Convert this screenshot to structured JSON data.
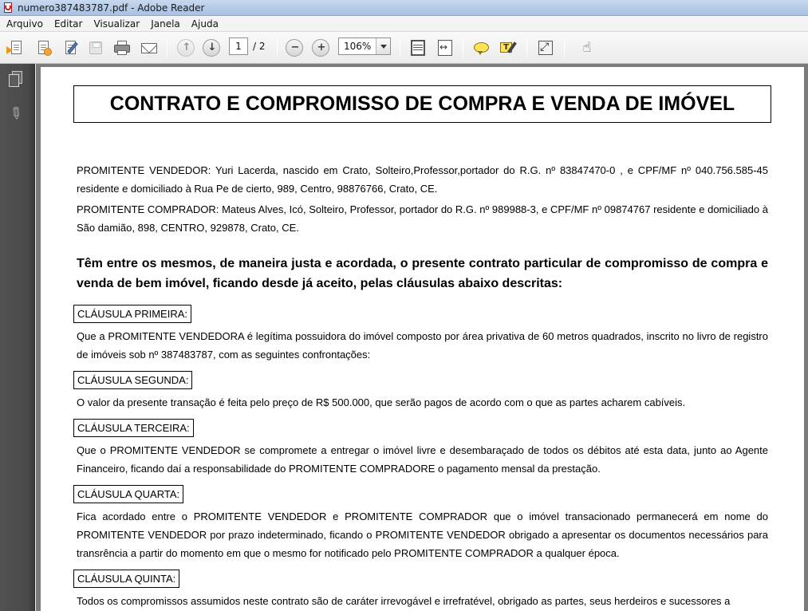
{
  "window": {
    "title": "numero387483787.pdf - Adobe Reader"
  },
  "menu": {
    "items": [
      "Arquivo",
      "Editar",
      "Visualizar",
      "Janela",
      "Ajuda"
    ]
  },
  "toolbar": {
    "current_page": "1",
    "total_pages": "/ 2",
    "zoom": "106%",
    "icons": [
      "open-file-icon",
      "create-pdf-icon",
      "sign-icon",
      "save-icon",
      "print-icon",
      "email-icon",
      "previous-page-icon",
      "next-page-icon",
      "zoom-out-icon",
      "zoom-in-icon",
      "fit-page-icon",
      "fit-width-icon",
      "comment-icon",
      "highlight-icon",
      "full-screen-icon",
      "hand-tool-icon"
    ]
  },
  "sidepanel": {
    "icons": [
      "pages-icon",
      "attachments-icon"
    ]
  },
  "document": {
    "title": "CONTRATO E COMPROMISSO DE COMPRA E VENDA DE IMÓVEL",
    "vendedor": "PROMITENTE VENDEDOR: Yuri Lacerda, nascido em Crato, Solteiro,Professor,portador do R.G. nº 83847470-0 ,  e CPF/MF nº 040.756.585-45 residente e domiciliado à Rua Pe de cierto, 989, Centro, 98876766, Crato, CE.",
    "comprador": "PROMITENTE COMPRADOR: Mateus Alves, Icó, Solteiro, Professor, portador do R.G. nº 989988-3, e CPF/MF nº 09874767 residente e domiciliado à São damião, 898, CENTRO, 929878, Crato, CE.",
    "intro": "Têm entre os mesmos, de maneira justa e acordada, o presente contrato particular de compromisso de compra e venda de bem imóvel, ficando desde já aceito, pelas cláusulas abaixo descritas:",
    "clauses": [
      {
        "title": "CLÁUSULA PRIMEIRA:",
        "text": "Que a PROMITENTE VENDEDORA é legítima possuidora do imóvel composto por área privativa de 60 metros quadrados, inscrito no livro de registro de imóveis sob nº 387483787, com as seguintes confrontações:"
      },
      {
        "title": "CLÁUSULA SEGUNDA:",
        "text": "O valor da presente transação é feita pelo preço de R$ 500.000, que serão pagos de acordo com o que as partes acharem cabíveis."
      },
      {
        "title": "CLÁUSULA TERCEIRA:",
        "text": "Que o PROMITENTE VENDEDOR se compromete a entregar o imóvel livre e desembaraçado de todos os débitos até esta data, junto ao Agente Financeiro, ficando daí a responsabilidade do PROMITENTE COMPRADORE o pagamento mensal da prestação."
      },
      {
        "title": "CLÁUSULA QUARTA:",
        "text": "Fica acordado entre o PROMITENTE VENDEDOR e PROMITENTE COMPRADOR que o imóvel transacionado permanecerá em nome do PROMITENTE VENDEDOR por prazo indeterminado, ficando o PROMITENTE VENDEDOR obrigado a apresentar os documentos necessários para transrência a partir do momento em que o mesmo for notificado pelo PROMITENTE COMPRADOR a qualquer época."
      },
      {
        "title": "CLÁUSULA QUINTA:",
        "text": "Todos os compromissos assumidos neste contrato são de caráter irrevogável e irrefratével, obrigado as partes, seus herdeiros e sucessores a"
      }
    ]
  }
}
